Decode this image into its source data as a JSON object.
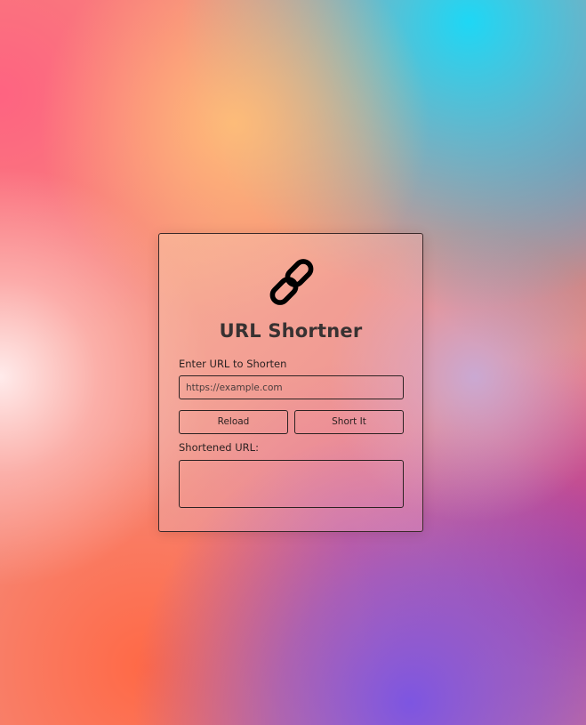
{
  "app": {
    "title": "URL Shortner",
    "logo_icon": "link-icon"
  },
  "form": {
    "input_label": "Enter URL to Shorten",
    "input_placeholder": "https://example.com",
    "input_value": "",
    "reload_label": "Reload",
    "submit_label": "Short It",
    "output_label": "Shortened URL:",
    "output_value": ""
  },
  "colors": {
    "text": "#2c2222",
    "title": "#383232",
    "border": "#2c2222"
  }
}
